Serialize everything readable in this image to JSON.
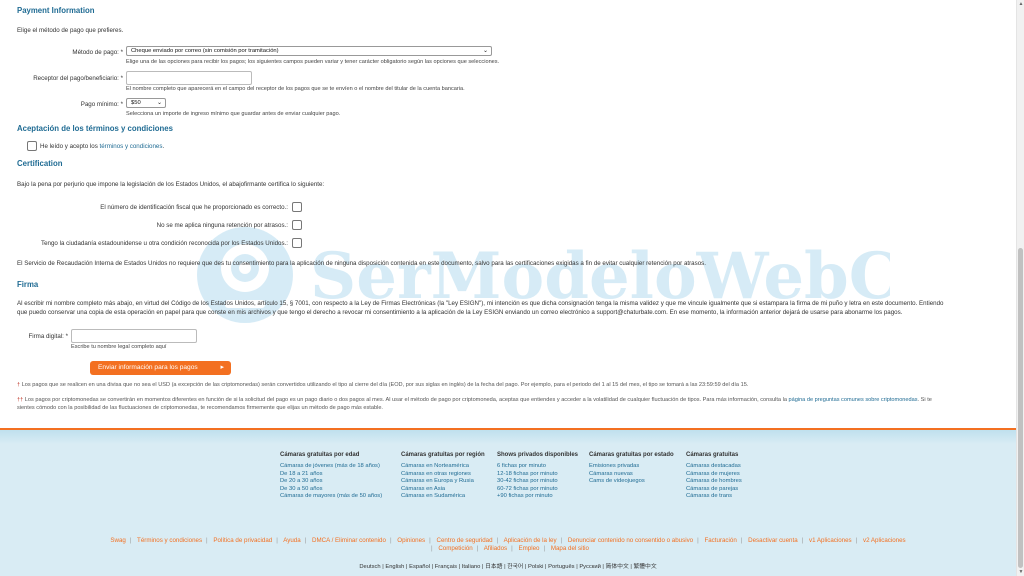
{
  "payment": {
    "title": "Payment Information",
    "intro": "Elige el método de pago que prefieres.",
    "method_label": "Método de pago: *",
    "method_value": "Cheque enviado por correo (sin comisión por tramitación)",
    "method_hint": "Elige una de las opciones para recibir los pagos; los siguientes campos pueden variar y tener carácter obligatorio según las opciones que selecciones.",
    "payee_label": "Receptor del pago/beneficiario: *",
    "payee_value": "",
    "payee_hint": "El nombre completo que aparecerá en el campo del receptor de los pagos que se te envíen o el nombre del titular de la cuenta bancaria.",
    "min_label": "Pago mínimo: *",
    "min_value": "$50",
    "min_hint": "Selecciona un importe de ingreso mínimo que guardar antes de enviar cualquier pago."
  },
  "terms": {
    "title": "Aceptación de los términos y condiciones",
    "checkbox_text": "He leído y acepto los ",
    "link_text": "términos y condiciones",
    "period": "."
  },
  "certification": {
    "title": "Certification",
    "intro": "Bajo la pena por perjurio que impone la legislación de los Estados Unidos, el abajofirmante certifica lo siguiente:",
    "items": [
      {
        "label": "El número de identificación fiscal que he proporcionado es correcto.:"
      },
      {
        "label": "No se me aplica ninguna retención por atrasos.:"
      },
      {
        "label": "Tengo la ciudadanía estadounidense u otra condición reconocida por los Estados Unidos.:"
      }
    ],
    "irs_note": "El Servicio de Recaudación Interna de Estados Unidos no requiere que des tu consentimiento para la aplicación de ninguna disposición contenida en este documento, salvo para las certificaciones exigidas a fin de evitar cualquier retención por atrasos."
  },
  "signature": {
    "title": "Firma",
    "text_line1": "Al escribir mi nombre completo más abajo, en virtud del Código de los Estados Unidos, artículo 15, § 7001, con respecto a la Ley de Firmas Electrónicas (la \"Ley ESIGN\"), mi intención es que dicha consignación tenga la misma validez y que me vincule igualmente que si estampara la firma de mi puño y letra en este documento. Entiendo",
    "text_line2": "que puedo conservar una copia de esta operación en papel para que conste en mis archivos y que tengo el derecho a revocar mi consentimiento a la aplicación de la Ley ESIGN enviando un correo electrónico a support@chaturbate.com. En ese momento, la información anterior dejará de usarse para abonarme los pagos.",
    "field_label": "Firma digital: *",
    "field_value": "",
    "field_hint": "Escribe tu nombre legal completo aquí",
    "submit_label": "Enviar información para los pagos"
  },
  "notes": {
    "note1_mark": "†",
    "note1": "Los pagos que se realicen en una divisa que no sea el USD (a excepción de las criptomonedas) serán convertidos utilizando el tipo al cierre del día (EOD, por sus siglas en inglés) de la fecha del pago. Por ejemplo, para el periodo del 1 al 15 del mes, el tipo se tomará a las 23:59:59 del día 15.",
    "note2_mark": "††",
    "note2_line1": "Los pagos por criptomonedas se convertirán en momentos diferentes en función de si la solicitud del pago es un pago diario o dos pagos al mes. Al usar el método de pago por criptomoneda, aceptas que entiendes y acceder a la volatilidad de cualquier fluctuación de tipos. Para más información, consulta la ",
    "note2_link": "página de preguntas comunes sobre criptomonedas",
    "note2_after": ". Si te",
    "note2_line2": "sientes cómodo con la posibilidad de las fluctuaciones de criptomonedas, te recomendamos firmemente que elijas un método de pago más estable."
  },
  "watermark": {
    "text": "SerModeloWebCam"
  },
  "footer": {
    "columns": [
      {
        "title": "Cámaras gratuitas por edad",
        "links": [
          "Cámaras de jóvenes (más de 18 años)",
          "De 18 a 21 años",
          "De 20 a 30 años",
          "De 30 a 50 años",
          "Cámaras de mayores (más de 50 años)"
        ]
      },
      {
        "title": "Cámaras gratuitas por región",
        "links": [
          "Cámaras en Norteamérica",
          "Cámaras en otras regiones",
          "Cámaras en Europa y Rusia",
          "Cámaras en Asia",
          "Cámaras en Sudamérica"
        ]
      },
      {
        "title": "Shows privados disponibles",
        "links": [
          "6 fichas por minuto",
          "12-18 fichas por minuto",
          "30-42 fichas por minuto",
          "60-72 fichas por minuto",
          "+90 fichas por minuto"
        ]
      },
      {
        "title": "Cámaras gratuitas por estado",
        "links": [
          "Emisiones privadas",
          "Cámaras nuevas",
          "Cams de videojuegos"
        ]
      },
      {
        "title": "Cámaras gratuitas",
        "links": [
          "Cámaras destacadas",
          "Cámaras de mujeres",
          "Cámaras de hombres",
          "Cámaras de parejas",
          "Cámaras de trans"
        ]
      }
    ],
    "bottom_links_row1": [
      "Swag",
      "Términos y condiciones",
      "Política de privacidad",
      "Ayuda",
      "DMCA / Eliminar contenido",
      "Opiniones",
      "Centro de seguridad",
      "Aplicación de la ley",
      "Denunciar contenido no consentido o abusivo",
      "Facturación",
      "Desactivar cuenta",
      "v1 Aplicaciones",
      "v2 Aplicaciones"
    ],
    "bottom_links_row2": [
      "Competición",
      "Afiliados",
      "Empleo",
      "Mapa del sitio"
    ],
    "languages": "Deutsch | English | Español | Français | Italiano | 日本語 | 한국어 | Polski | Português | Русский | 简体中文 | 繁體中文"
  },
  "colors": {
    "accent": "#f37021",
    "link": "#1f6b93",
    "footer_bg": "#d9ecf4"
  }
}
